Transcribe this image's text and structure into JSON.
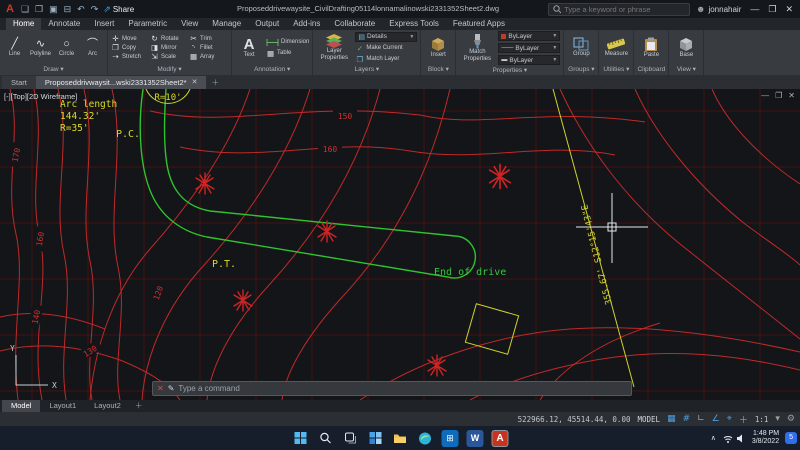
{
  "titlebar": {
    "share": "Share",
    "filename": "Proposeddrivewaysite_CivilDrafting05114lonnamalinowski2331352Sheet2.dwg",
    "search_placeholder": "Type a keyword or phrase",
    "user": "jonnahair"
  },
  "tabs": [
    "Home",
    "Annotate",
    "Insert",
    "Parametric",
    "View",
    "Manage",
    "Output",
    "Add-ins",
    "Collaborate",
    "Express Tools",
    "Featured Apps"
  ],
  "ribbon": {
    "draw": {
      "label": "Draw",
      "tools": [
        "Line",
        "Polyline",
        "Circle",
        "Arc"
      ]
    },
    "modify": {
      "label": "Modify",
      "tools": [
        "Move",
        "Rotate",
        "Trim",
        "Copy",
        "Mirror",
        "Fillet",
        "Stretch",
        "Scale",
        "Array"
      ]
    },
    "annotation": {
      "label": "Annotation",
      "text": "Text",
      "dimension": "Dimension",
      "table": "Table"
    },
    "layers": {
      "label": "Layers",
      "properties": "Layer Properties",
      "details": "Details",
      "make_current": "Make Current",
      "match_layer": "Match Layer"
    },
    "block": {
      "label": "Block",
      "insert": "Insert"
    },
    "properties": {
      "label": "Properties",
      "match": "Match Properties",
      "bylayer": "ByLayer"
    },
    "groups": {
      "label": "Groups",
      "group": "Group"
    },
    "utilities": {
      "label": "Utilities",
      "measure": "Measure"
    },
    "clipboard": {
      "label": "Clipboard",
      "paste": "Paste"
    },
    "view": {
      "label": "View",
      "base": "Base"
    }
  },
  "filetabs": {
    "start": "Start",
    "doc": "Proposeddrivwaysit...wski2331352Sheet2*"
  },
  "drawing": {
    "viewport": "[-][Top][2D Wireframe]",
    "arc_note_1": "Arc length",
    "arc_note_2": "144.32'",
    "arc_note_3": "R=35'",
    "r10": "R=10'",
    "pc": "P.C.",
    "pt": "P.T.",
    "end_of_drive": "End of drive",
    "bearing": "355.67' S12°15'43\"E",
    "contour_labels": [
      "150",
      "160",
      "170",
      "160",
      "140",
      "120",
      "130"
    ],
    "ucs_y": "Y",
    "ucs_x": "X"
  },
  "command": {
    "placeholder": "Type a command"
  },
  "layouts": {
    "model": "Model",
    "layout1": "Layout1",
    "layout2": "Layout2"
  },
  "statusbar": {
    "coords": "522966.12, 45514.44, 0.00",
    "model": "MODEL",
    "scale": "1:1"
  },
  "taskbar": {
    "time": "1:48 PM",
    "date": "3/8/2022",
    "badge": "5"
  }
}
